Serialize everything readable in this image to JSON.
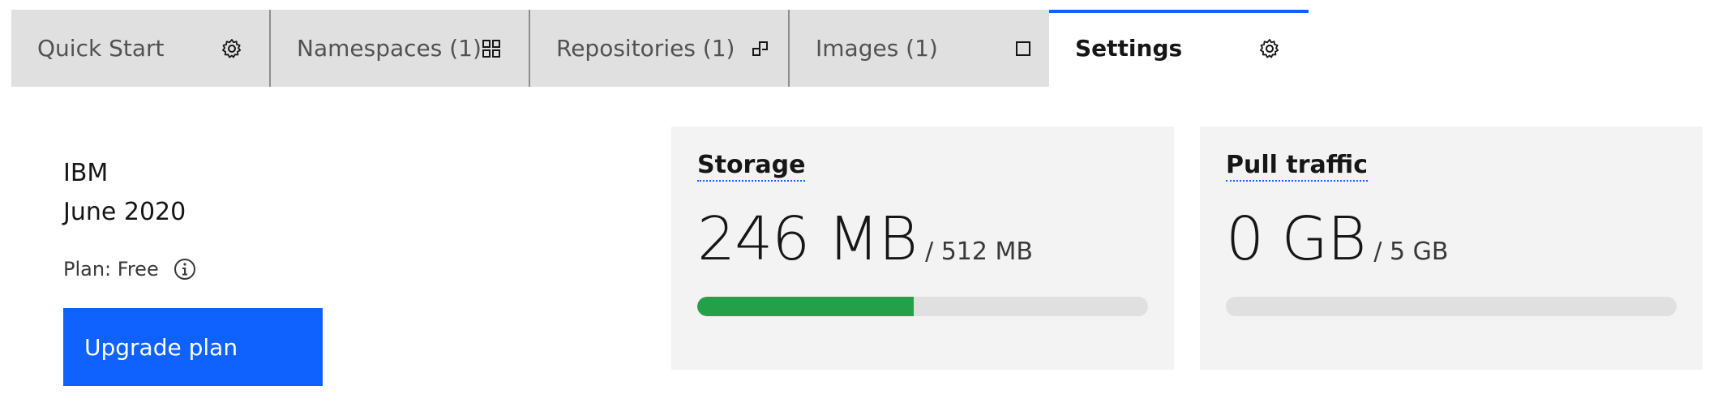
{
  "tabs": [
    {
      "label": "Quick Start",
      "icon": "gear-icon",
      "active": false
    },
    {
      "label": "Namespaces  (1)",
      "icon": "grid-icon",
      "active": false
    },
    {
      "label": "Repositories  (1)",
      "icon": "repository-icon",
      "active": false
    },
    {
      "label": "Images  (1)",
      "icon": "square-icon",
      "active": false
    },
    {
      "label": "Settings",
      "icon": "gear-icon",
      "active": true
    }
  ],
  "account": {
    "org": "IBM",
    "date": "June 2020",
    "plan": "Plan: Free",
    "plan_icon": "info-icon",
    "upgrade_label": "Upgrade plan"
  },
  "storage": {
    "title": "Storage",
    "used": "246 MB",
    "limit": "/ 512 MB",
    "fraction": 0.4805,
    "bar_color": "#24a148"
  },
  "traffic": {
    "title": "Pull traffic",
    "used": "0 GB",
    "limit": "/ 5 GB",
    "fraction": 0.0,
    "bar_color": "#24a148"
  },
  "colors": {
    "accent": "#0f62fe",
    "tab_bg": "#e0e0e0",
    "tile_bg": "#f3f3f3",
    "progress": "#24a148"
  }
}
